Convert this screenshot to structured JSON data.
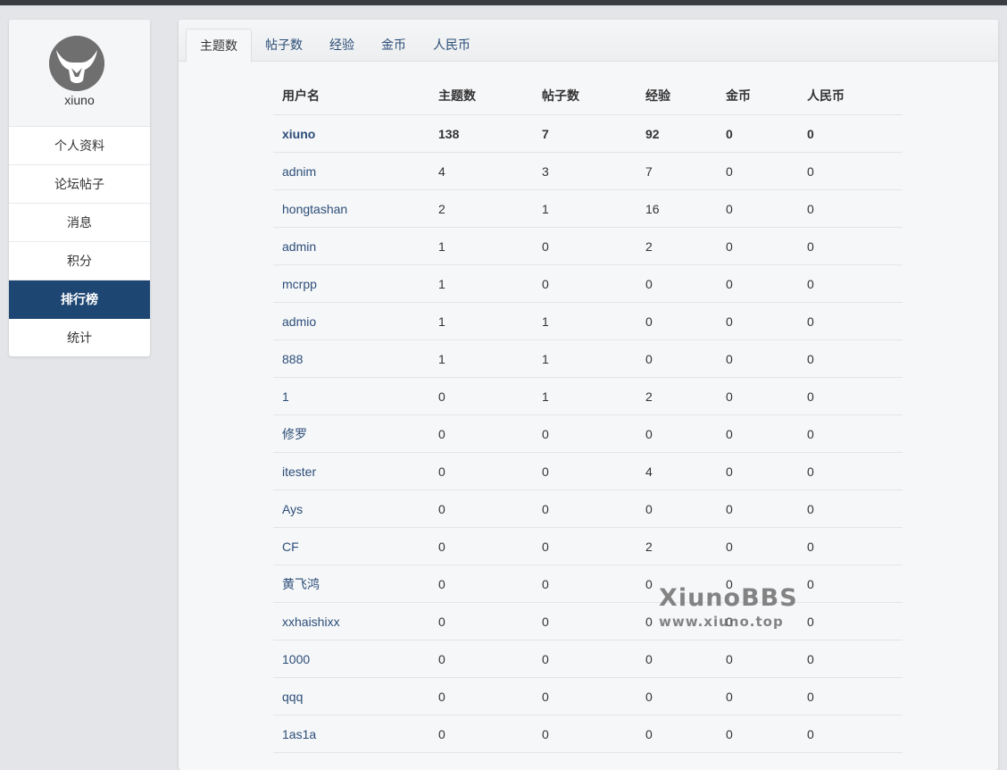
{
  "profile": {
    "username": "xiuno"
  },
  "sidebar": {
    "items": [
      {
        "label": "个人资料"
      },
      {
        "label": "论坛帖子"
      },
      {
        "label": "消息"
      },
      {
        "label": "积分"
      },
      {
        "label": "排行榜"
      },
      {
        "label": "统计"
      }
    ],
    "active_index": 4
  },
  "tabs": [
    {
      "label": "主题数"
    },
    {
      "label": "帖子数"
    },
    {
      "label": "经验"
    },
    {
      "label": "金币"
    },
    {
      "label": "人民币"
    }
  ],
  "active_tab": 0,
  "table": {
    "headers": [
      "用户名",
      "主题数",
      "帖子数",
      "经验",
      "金币",
      "人民币"
    ],
    "rows": [
      [
        "xiuno",
        "138",
        "7",
        "92",
        "0",
        "0"
      ],
      [
        "adnim",
        "4",
        "3",
        "7",
        "0",
        "0"
      ],
      [
        "hongtashan",
        "2",
        "1",
        "16",
        "0",
        "0"
      ],
      [
        "admin",
        "1",
        "0",
        "2",
        "0",
        "0"
      ],
      [
        "mcrpp",
        "1",
        "0",
        "0",
        "0",
        "0"
      ],
      [
        "admio",
        "1",
        "1",
        "0",
        "0",
        "0"
      ],
      [
        "888",
        "1",
        "1",
        "0",
        "0",
        "0"
      ],
      [
        "1",
        "0",
        "1",
        "2",
        "0",
        "0"
      ],
      [
        "修罗",
        "0",
        "0",
        "0",
        "0",
        "0"
      ],
      [
        "itester",
        "0",
        "0",
        "4",
        "0",
        "0"
      ],
      [
        "Ays",
        "0",
        "0",
        "0",
        "0",
        "0"
      ],
      [
        "CF",
        "0",
        "0",
        "2",
        "0",
        "0"
      ],
      [
        "黄飞鸿",
        "0",
        "0",
        "0",
        "0",
        "0"
      ],
      [
        "xxhaishixx",
        "0",
        "0",
        "0",
        "0",
        "0"
      ],
      [
        "1000",
        "0",
        "0",
        "0",
        "0",
        "0"
      ],
      [
        "qqq",
        "0",
        "0",
        "0",
        "0",
        "0"
      ],
      [
        "1as1a",
        "0",
        "0",
        "0",
        "0",
        "0"
      ]
    ]
  },
  "watermark": {
    "line1": "XiunoBBS",
    "line2": "www.xiuno.top"
  },
  "colors": {
    "accent": "#1e4673",
    "link": "#2c4e78",
    "topbar": "#3a3d42"
  }
}
